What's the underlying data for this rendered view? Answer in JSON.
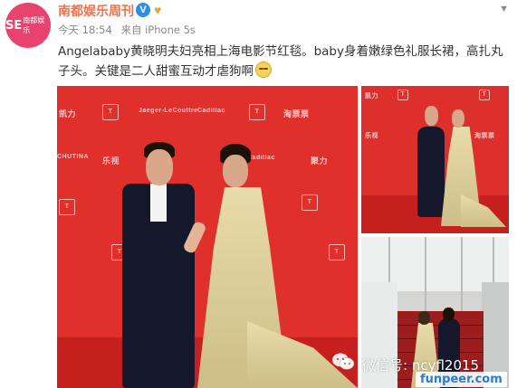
{
  "post": {
    "author": "南都娱乐周刊",
    "avatar_text": "SE",
    "avatar_sub": "南都娱乐",
    "verified_badge": "V",
    "time": "今天 18:54",
    "source": "来自 iPhone 5s",
    "text": "Angelababy黄晓明夫妇亮相上海电影节红毯。baby身着嫩绿色礼服长裙，高扎丸子头。关键是二人甜蜜互动才虐狗啊"
  },
  "photos": {
    "wall_logos": [
      "凯力",
      "Jaeger-LeCoultre",
      "Cadillac",
      "淘票票",
      "CHUTINA",
      "乐视",
      "Cadillac",
      "聚力"
    ]
  },
  "watermarks": {
    "wechat": "微信号: ncyfl2015",
    "site": "funpeer.com"
  },
  "icons": {
    "verified": "verified-badge-icon",
    "fan": "fan-badge-icon",
    "menu": "chevron-down-icon",
    "emoji": "smile-emoji-icon",
    "wechat": "wechat-icon"
  },
  "colors": {
    "author": "#eb7350",
    "avatar_bg": "#e8426f",
    "red_carpet": "#e0302c",
    "site_watermark": "#2a7dc9"
  }
}
